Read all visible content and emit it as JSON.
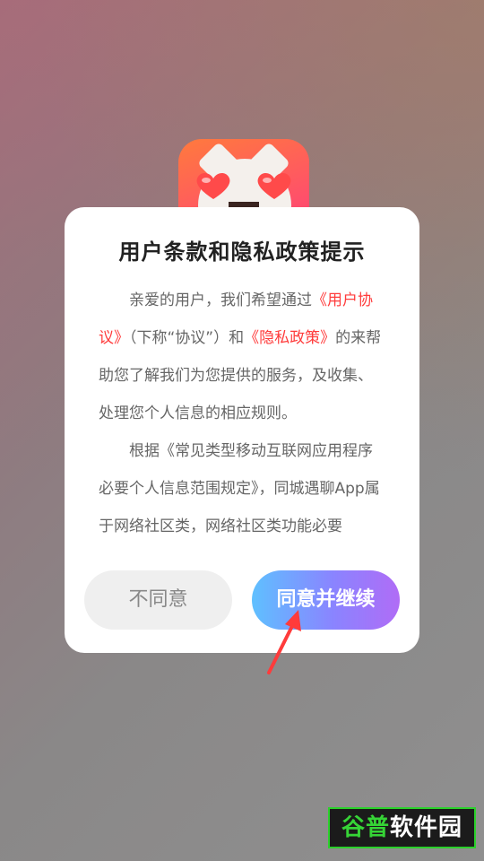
{
  "dialog": {
    "title": "用户条款和隐私政策提示",
    "paragraph1": {
      "text_before": "亲爱的用户，我们希望通过",
      "link1": "《用户协议》",
      "text_middle": "（下称“协议”）和",
      "link2": "《隐私政策》",
      "text_after": "的来帮助您了解我们为您提供的服务，及收集、处理您个人信息的相应规则。"
    },
    "paragraph2": "根据《常见类型移动互联网应用程序必要个人信息范围规定》，同城遇聊App属于网络社区类，网络社区类功能必要",
    "decline_label": "不同意",
    "accept_label": "同意并继续"
  },
  "watermark": {
    "brand_part1": "谷普",
    "brand_part2": "软件园"
  },
  "colors": {
    "link": "#ff3b3b",
    "accept_gradient_start": "#5fc0ff",
    "accept_gradient_end": "#b06cf6",
    "arrow": "#ff3b3b"
  },
  "icons": {
    "app_logo": "app-logo-cat-icon",
    "arrow": "pointer-arrow-icon"
  }
}
